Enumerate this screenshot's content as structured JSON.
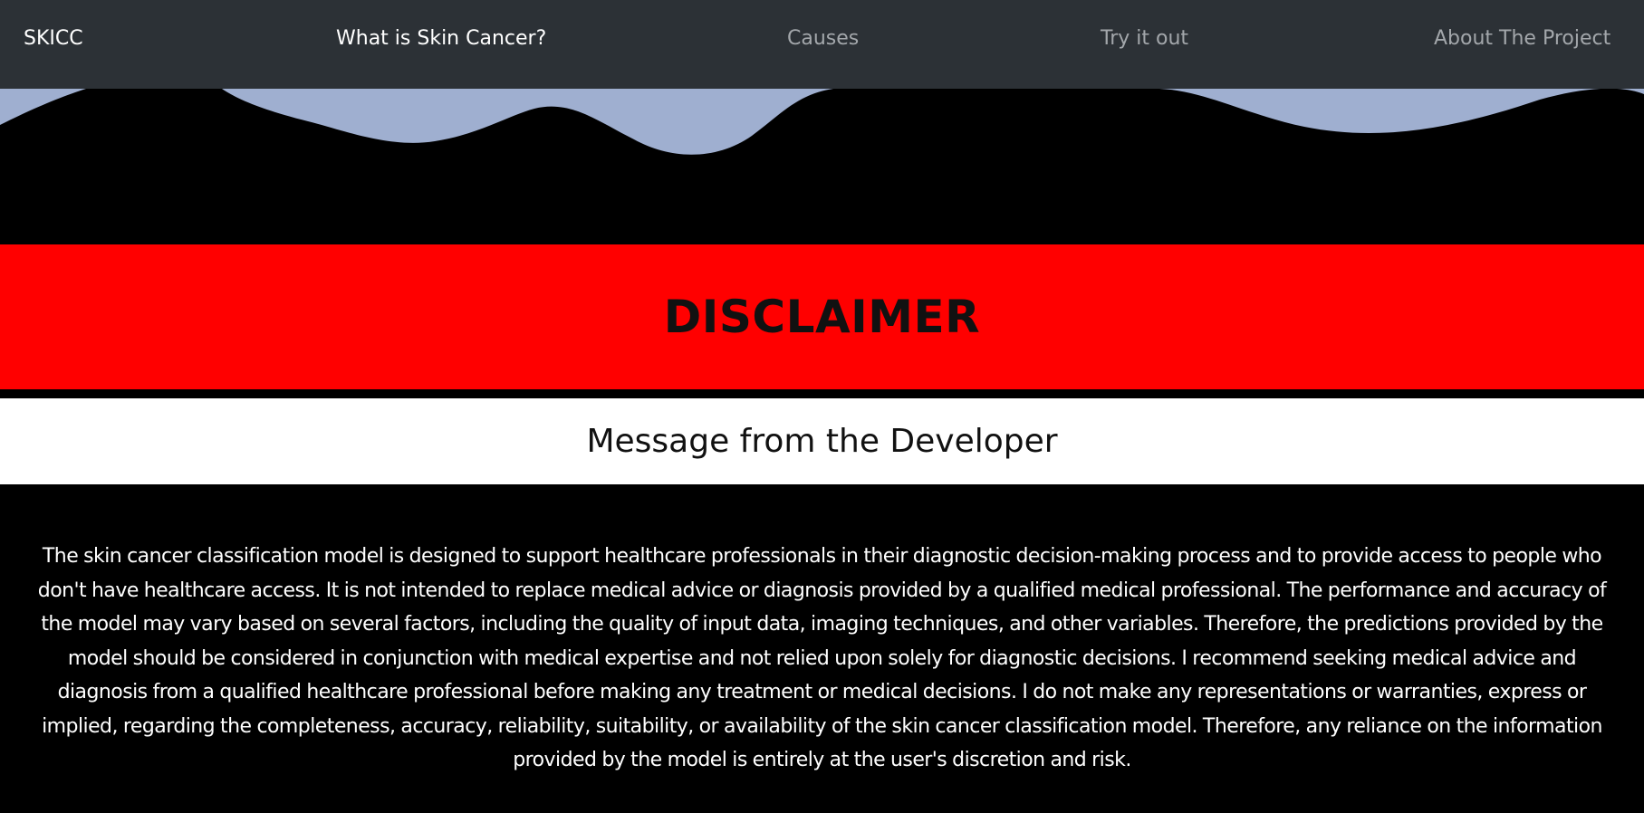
{
  "nav": {
    "brand": "SKICC",
    "links": [
      {
        "label": "What is Skin Cancer?",
        "active": true
      },
      {
        "label": "Causes",
        "active": false
      },
      {
        "label": "Try it out",
        "active": false
      },
      {
        "label": "About The Project",
        "active": false
      }
    ]
  },
  "disclaimer": {
    "title": "DISCLAIMER"
  },
  "message": {
    "title": "Message from the Developer",
    "body": "The skin cancer classification model is designed to support healthcare professionals in their diagnostic decision-making process and to provide access to people who don't have healthcare access. It is not intended to replace medical advice or diagnosis provided by a qualified medical professional. The performance and accuracy of the model may vary based on several factors, including the quality of input data, imaging techniques, and other variables. Therefore, the predictions provided by the model should be considered in conjunction with medical expertise and not relied upon solely for diagnostic decisions. I recommend seeking medical advice and diagnosis from a qualified healthcare professional before making any treatment or medical decisions. I do not make any representations or warranties, express or implied, regarding the completeness, accuracy, reliability, suitability, or availability of the skin cancer classification model. Therefore, any reliance on the information provided by the model is entirely at the user's discretion and risk."
  },
  "colors": {
    "navbar": "#2c3136",
    "wave": "#9fafd0",
    "disclaimer_band": "#ff0000",
    "background": "#000000"
  }
}
